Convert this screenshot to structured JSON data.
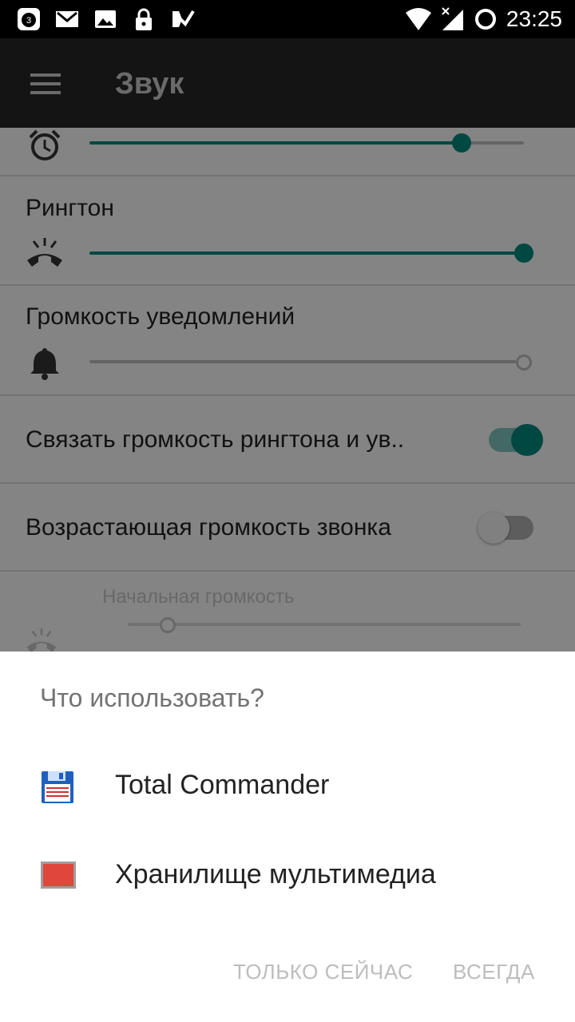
{
  "status_bar": {
    "time": "23:25",
    "notification_badge": "3",
    "icons": [
      "notification-count-icon",
      "gmail-icon",
      "image-icon",
      "lock-icon",
      "tasks-icon",
      "wifi-icon",
      "signal-icon",
      "sync-icon"
    ]
  },
  "app_bar": {
    "title": "Звук",
    "menu_icon": "hamburger-menu-icon"
  },
  "settings": {
    "alarm": {
      "icon": "alarm-clock-icon",
      "level": 0.86
    },
    "ringtone": {
      "label": "Рингтон",
      "icon": "ringing-phone-icon",
      "level": 1.0
    },
    "notifications": {
      "label": "Громкость уведомлений",
      "icon": "bell-icon",
      "level": 0.0
    },
    "link_volume": {
      "label": "Связать громкость рингтона и ув..",
      "enabled": true
    },
    "rising_volume": {
      "label": "Возрастающая громкость звонка",
      "enabled": false
    },
    "initial_volume": {
      "label": "Начальная громкость",
      "icon": "ringing-phone-icon",
      "level": 0.1
    }
  },
  "chooser": {
    "title": "Что использовать?",
    "apps": [
      {
        "label": "Total Commander",
        "icon": "floppy-disk-icon"
      },
      {
        "label": "Хранилище мультимедиа",
        "icon": "media-storage-icon"
      }
    ],
    "button_once": "ТОЛЬКО СЕЙЧАС",
    "button_always": "ВСЕГДА"
  },
  "colors": {
    "accent": "#00897b",
    "scrim": "#000000",
    "disabled_text": "#bdbdbd"
  }
}
